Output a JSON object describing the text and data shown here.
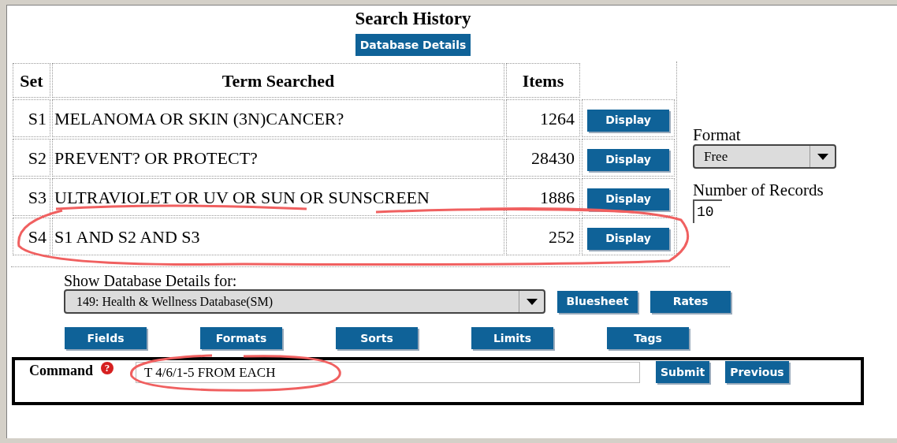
{
  "title": "Search History",
  "details_button": "Database Details",
  "table": {
    "columns": [
      "Set",
      "Term Searched",
      "Items"
    ],
    "rows": [
      {
        "set": "S1",
        "term": "MELANOMA OR SKIN (3N)CANCER?",
        "items": "1264",
        "button": "Display"
      },
      {
        "set": "S2",
        "term": "PREVENT? OR PROTECT?",
        "items": "28430",
        "button": "Display"
      },
      {
        "set": "S3",
        "term": "ULTRAVIOLET OR UV OR SUN OR SUNSCREEN",
        "items": "1886",
        "button": "Display"
      },
      {
        "set": "S4",
        "term": "S1 AND S2 AND S3",
        "items": "252",
        "button": "Display"
      }
    ]
  },
  "format": {
    "label": "Format",
    "value": "Free"
  },
  "records": {
    "label": "Number of Records",
    "value": "10"
  },
  "database": {
    "label": "Show Database Details for:",
    "value": "149: Health & Wellness Database(SM)",
    "buttons": [
      "Bluesheet",
      "Rates"
    ]
  },
  "tool_buttons": [
    "Fields",
    "Formats",
    "Sorts",
    "Limits",
    "Tags"
  ],
  "command": {
    "label": "Command",
    "help": "?",
    "value": "T 4/6/1-5 FROM EACH",
    "buttons": [
      "Submit",
      "Previous"
    ]
  }
}
